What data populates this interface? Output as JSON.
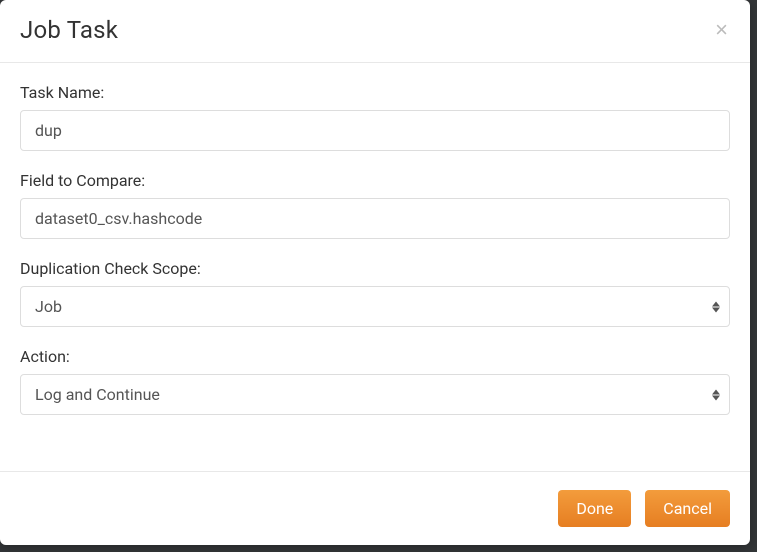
{
  "header": {
    "title": "Job Task"
  },
  "form": {
    "taskName": {
      "label": "Task Name:",
      "value": "dup"
    },
    "fieldToCompare": {
      "label": "Field to Compare:",
      "value": "dataset0_csv.hashcode"
    },
    "duplicationCheckScope": {
      "label": "Duplication Check Scope:",
      "value": "Job"
    },
    "action": {
      "label": "Action:",
      "value": "Log and Continue"
    }
  },
  "footer": {
    "done": "Done",
    "cancel": "Cancel"
  }
}
